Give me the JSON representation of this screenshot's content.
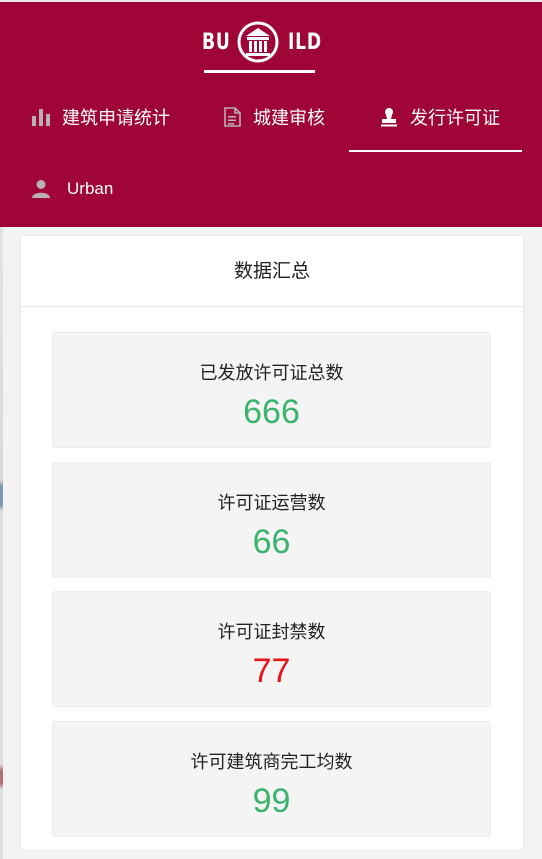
{
  "brand": {
    "left": "BU",
    "right": "ILD",
    "emblem_icon": "temple-icon"
  },
  "nav": {
    "items": [
      {
        "label": "建筑申请统计",
        "icon": "bar-chart-icon"
      },
      {
        "label": "城建审核",
        "icon": "document-icon"
      },
      {
        "label": "发行许可证",
        "icon": "stamp-icon",
        "active": true
      }
    ],
    "user": {
      "label": "Urban",
      "icon": "user-icon"
    }
  },
  "summary": {
    "title": "数据汇总",
    "stats": [
      {
        "label": "已发放许可证总数",
        "value": "666",
        "color": "#3cb36b"
      },
      {
        "label": "许可证运营数",
        "value": "66",
        "color": "#3cb36b"
      },
      {
        "label": "许可证封禁数",
        "value": "77",
        "color": "#e8141c"
      },
      {
        "label": "许可建筑商完工均数",
        "value": "99",
        "color": "#3cb36b"
      }
    ]
  },
  "colors": {
    "header_bg": "#a00537",
    "positive": "#3cb36b",
    "negative": "#e8141c"
  }
}
